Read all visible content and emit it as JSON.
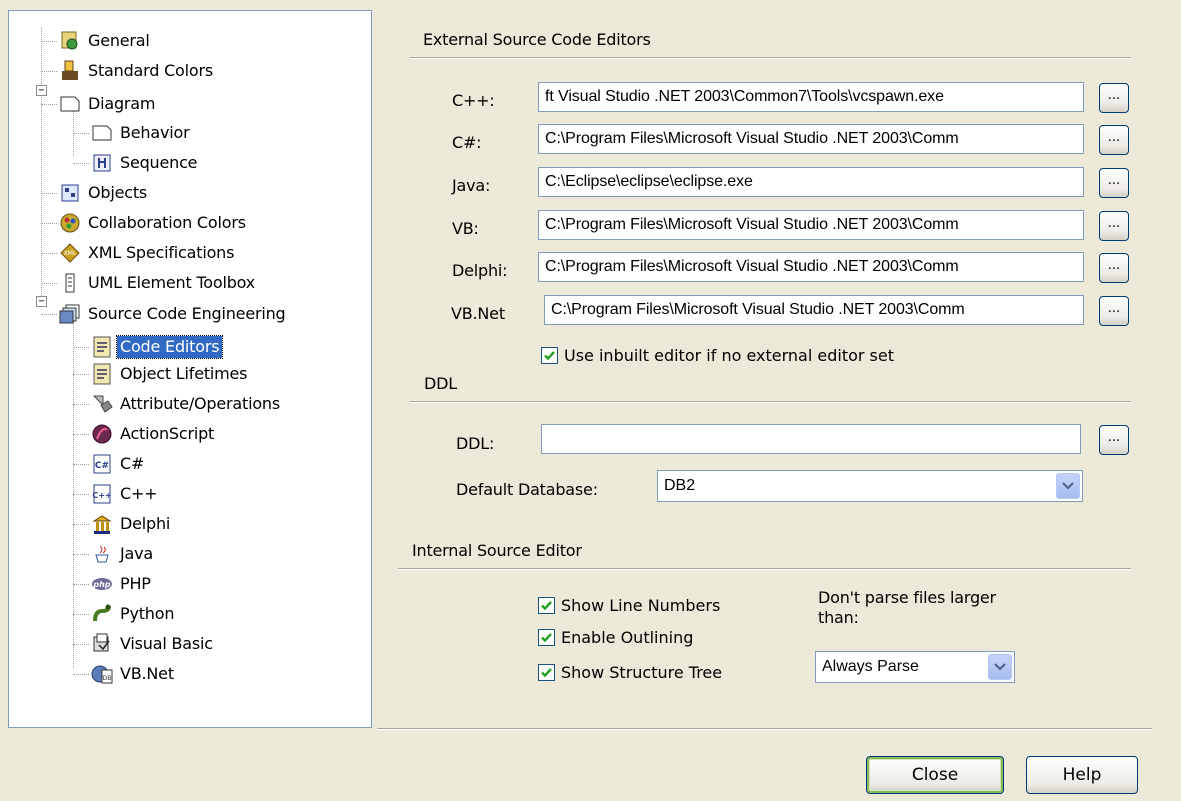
{
  "tree": {
    "items": [
      {
        "label": "General",
        "icon": "general-settings-icon"
      },
      {
        "label": "Standard Colors",
        "icon": "paint-palette-icon"
      },
      {
        "label": "Diagram",
        "icon": "page-icon",
        "expander": "−"
      },
      {
        "label": "Behavior",
        "icon": "page-icon"
      },
      {
        "label": "Sequence",
        "icon": "sequence-diagram-icon"
      },
      {
        "label": "Objects",
        "icon": "objects-icon"
      },
      {
        "label": "Collaboration Colors",
        "icon": "collaboration-colors-icon"
      },
      {
        "label": "XML Specifications",
        "icon": "xml-icon"
      },
      {
        "label": "UML Element Toolbox",
        "icon": "toolbox-icon"
      },
      {
        "label": "Source Code Engineering",
        "icon": "source-code-engineering-icon",
        "expander": "−"
      },
      {
        "label": "Code Editors",
        "icon": "code-editor-icon"
      },
      {
        "label": "Object Lifetimes",
        "icon": "code-editor-icon"
      },
      {
        "label": "Attribute/Operations",
        "icon": "attribute-operations-icon"
      },
      {
        "label": "ActionScript",
        "icon": "actionscript-icon"
      },
      {
        "label": "C#",
        "icon": "csharp-icon"
      },
      {
        "label": "C++",
        "icon": "cpp-icon"
      },
      {
        "label": "Delphi",
        "icon": "delphi-icon"
      },
      {
        "label": "Java",
        "icon": "java-icon"
      },
      {
        "label": "PHP",
        "icon": "php-icon"
      },
      {
        "label": "Python",
        "icon": "python-icon"
      },
      {
        "label": "Visual Basic",
        "icon": "visual-basic-icon"
      },
      {
        "label": "VB.Net",
        "icon": "vbnet-icon"
      }
    ]
  },
  "external": {
    "title": "External Source Code Editors",
    "browse_label": "...",
    "editors": [
      {
        "label": "C++:",
        "value": "ft Visual Studio .NET 2003\\Common7\\Tools\\vcspawn.exe"
      },
      {
        "label": "C#:",
        "value": "C:\\Program Files\\Microsoft Visual Studio .NET 2003\\Comm"
      },
      {
        "label": "Java:",
        "value": "C:\\Eclipse\\eclipse\\eclipse.exe"
      },
      {
        "label": "VB:",
        "value": "C:\\Program Files\\Microsoft Visual Studio .NET 2003\\Comm"
      },
      {
        "label": "Delphi:",
        "value": "C:\\Program Files\\Microsoft Visual Studio .NET 2003\\Comm"
      },
      {
        "label": "VB.Net",
        "value": "C:\\Program Files\\Microsoft Visual Studio .NET 2003\\Comm"
      }
    ],
    "use_inbuilt": {
      "label": "Use inbuilt editor if no external editor set",
      "checked": true
    }
  },
  "ddl": {
    "title": "DDL",
    "ddl_label": "DDL:",
    "ddl_value": "",
    "default_db_label": "Default Database:",
    "default_db_value": "DB2"
  },
  "internal": {
    "title": "Internal Source Editor",
    "checkboxes": [
      {
        "label": "Show Line Numbers",
        "checked": true
      },
      {
        "label": "Enable Outlining",
        "checked": true
      },
      {
        "label": "Show Structure Tree",
        "checked": true
      }
    ],
    "parse_label": "Don't parse files larger than:",
    "parse_value": "Always Parse"
  },
  "buttons": {
    "close": "Close",
    "help": "Help"
  },
  "colors": {
    "selection": "#316ac5",
    "background": "#ece9d8",
    "check": "#21a121"
  }
}
